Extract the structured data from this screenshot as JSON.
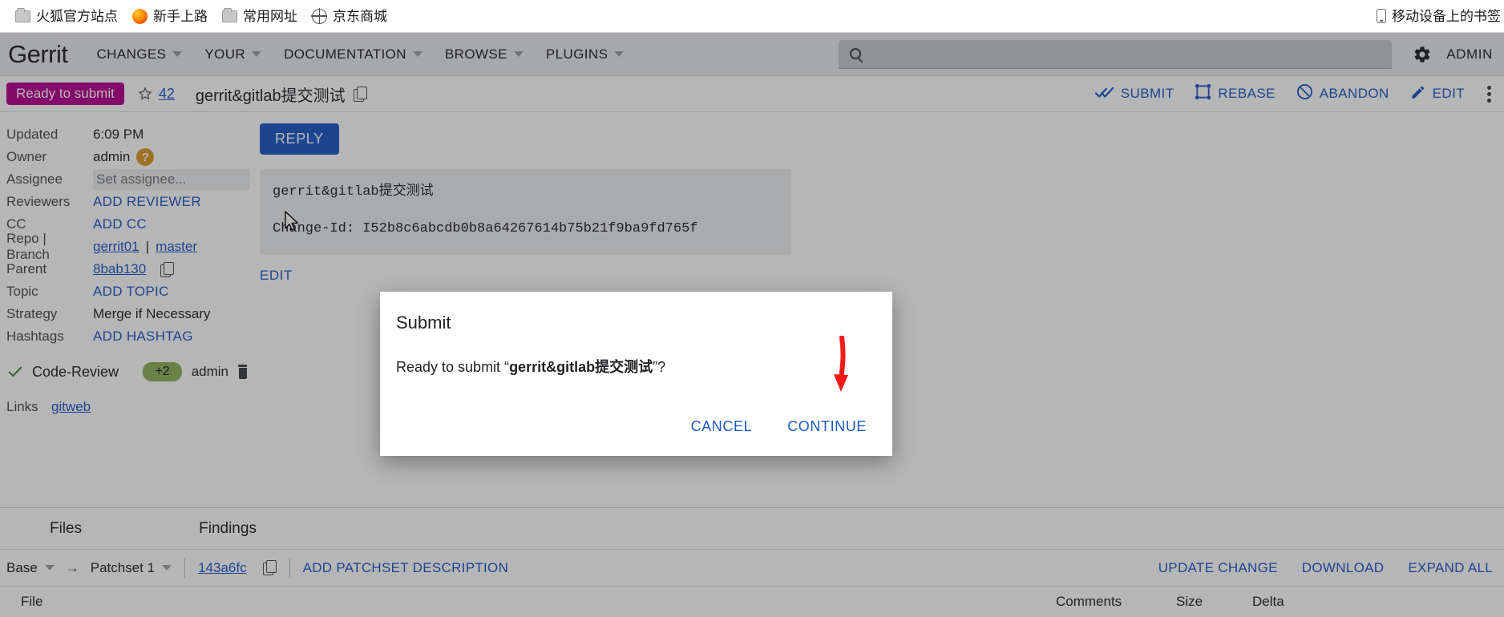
{
  "browser": {
    "bookmarks": [
      {
        "label": "火狐官方站点",
        "icon": "folder-icon"
      },
      {
        "label": "新手上路",
        "icon": "firefox-icon"
      },
      {
        "label": "常用网址",
        "icon": "folder-icon"
      },
      {
        "label": "京东商城",
        "icon": "globe-icon"
      }
    ],
    "mobile_bookmarks": {
      "label": "移动设备上的书签",
      "icon": "mobile-icon"
    }
  },
  "header": {
    "logo": "Gerrit",
    "nav": [
      {
        "label": "CHANGES",
        "has_caret": true
      },
      {
        "label": "YOUR",
        "has_caret": true
      },
      {
        "label": "DOCUMENTATION",
        "has_caret": true
      },
      {
        "label": "BROWSE",
        "has_caret": true
      },
      {
        "label": "PLUGINS",
        "has_caret": true
      }
    ],
    "search": {
      "value": "",
      "placeholder": "",
      "icon": "search-icon"
    },
    "settings_icon": "gear-icon",
    "account": "ADMIN"
  },
  "change": {
    "status": "Ready to submit",
    "status_color": "#b5008c",
    "star_icon": "star-icon",
    "number": "42",
    "title": "gerrit&gitlab提交测试",
    "copy_icon": "copy-icon",
    "actions": [
      {
        "label": "SUBMIT",
        "icon": "double-check-icon"
      },
      {
        "label": "REBASE",
        "icon": "rebase-icon"
      },
      {
        "label": "ABANDON",
        "icon": "abandon-icon"
      },
      {
        "label": "EDIT",
        "icon": "pencil-icon"
      }
    ],
    "overflow_icon": "kebab-menu-icon"
  },
  "metadata": [
    {
      "key": "Updated",
      "value": "6:09 PM",
      "type": "text"
    },
    {
      "key": "Owner",
      "value": "admin",
      "type": "owner",
      "avatar": "?"
    },
    {
      "key": "Assignee",
      "value": "",
      "placeholder": "Set assignee...",
      "type": "input"
    },
    {
      "key": "Reviewers",
      "value": "ADD REVIEWER",
      "type": "link"
    },
    {
      "key": "CC",
      "value": "ADD CC",
      "type": "link"
    },
    {
      "key": "Repo | Branch",
      "repo": "gerrit01",
      "branch": "master",
      "type": "repo"
    },
    {
      "key": "Parent",
      "value": "8bab130",
      "type": "parent",
      "copy_icon": "copy-icon"
    },
    {
      "key": "Topic",
      "value": "ADD TOPIC",
      "type": "link"
    },
    {
      "key": "Strategy",
      "value": "Merge if Necessary",
      "type": "text"
    },
    {
      "key": "Hashtags",
      "value": "ADD HASHTAG",
      "type": "link"
    }
  ],
  "vote": {
    "check_icon": "green-check-icon",
    "label": "Code-Review",
    "score": "+2",
    "score_color": "#8bb25a",
    "user": "admin",
    "remove_icon": "trash-icon"
  },
  "links": {
    "key": "Links",
    "value": "gitweb"
  },
  "main": {
    "reply_label": "REPLY",
    "commit_subject": "gerrit&gitlab提交测试",
    "commit_change_id": "Change-Id: I52b8c6abcdb0b8a64267614b75b21f9ba9fd765f",
    "edit_label": "EDIT",
    "cursor_icon": "mouse-pointer-icon"
  },
  "files": {
    "tabs": [
      {
        "label": "Files",
        "active": true
      },
      {
        "label": "Findings",
        "active": false
      }
    ],
    "patchset": {
      "base": "Base",
      "arrow": "→",
      "target": "Patchset 1",
      "revision": "143a6fc",
      "copy_icon": "copy-icon",
      "add_description": "ADD PATCHSET DESCRIPTION"
    },
    "actions": [
      {
        "label": "UPDATE CHANGE"
      },
      {
        "label": "DOWNLOAD"
      },
      {
        "label": "EXPAND ALL"
      }
    ],
    "columns": [
      "File",
      "Comments",
      "Size",
      "Delta"
    ]
  },
  "modal": {
    "title": "Submit",
    "message_prefix": "Ready to submit “",
    "message_target": "gerrit&gitlab提交测试",
    "message_suffix": "”?",
    "cancel_label": "CANCEL",
    "continue_label": "CONTINUE"
  },
  "annotation": {
    "type": "red-arrow",
    "color": "#f21a1a",
    "points_to": "CONTINUE"
  }
}
